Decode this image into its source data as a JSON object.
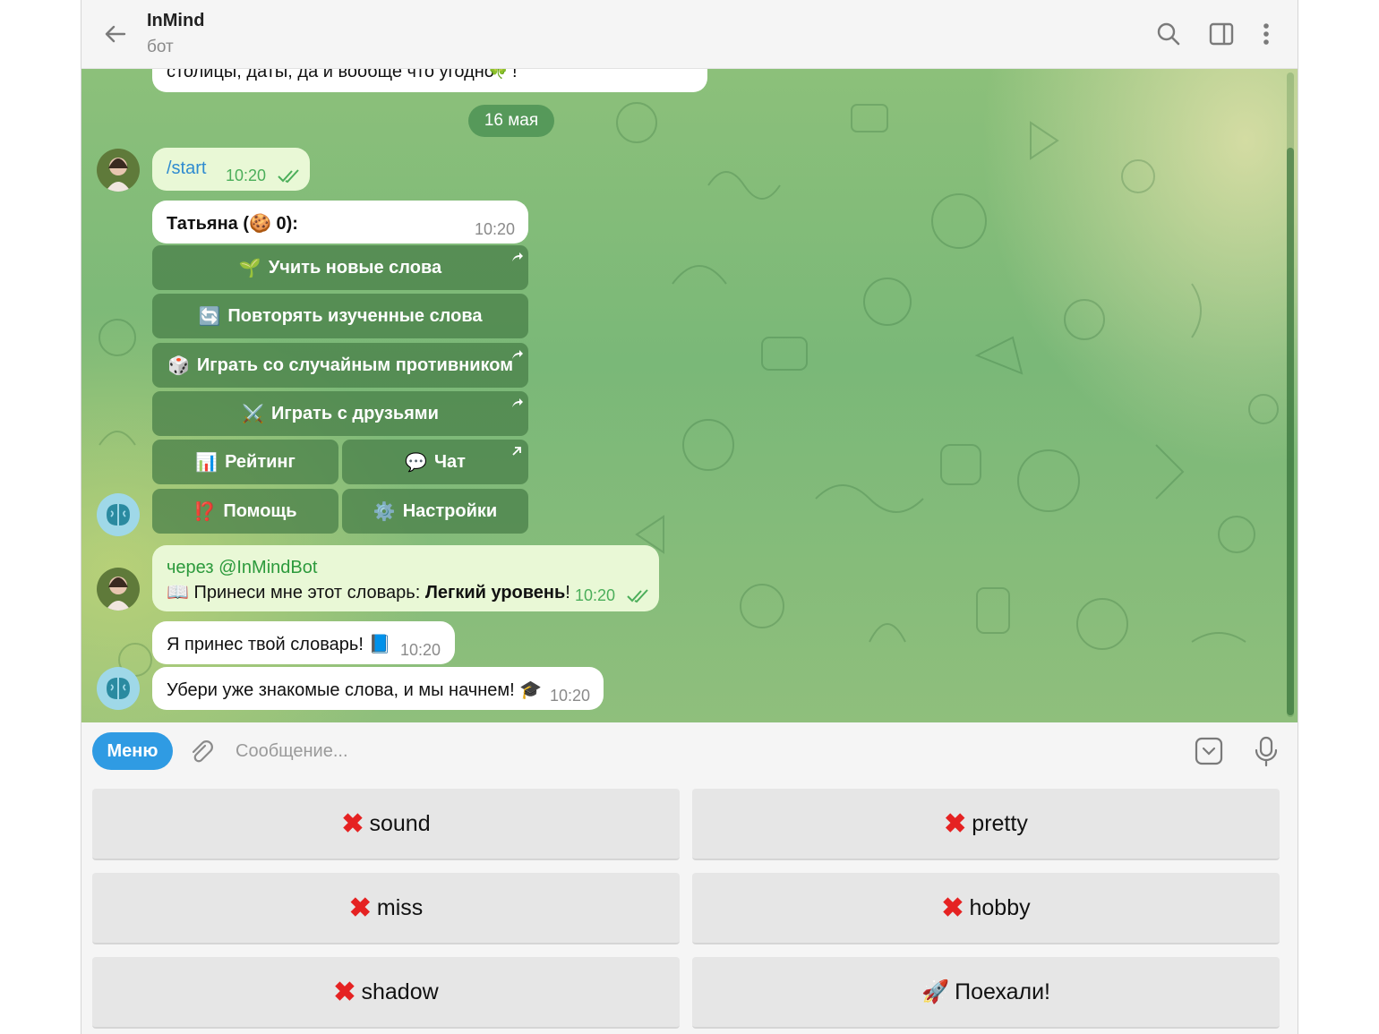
{
  "header": {
    "title": "InMind",
    "subtitle": "бот"
  },
  "chat": {
    "partial_text": "столицы, даты, да и вообще что угодно",
    "date_label": "16 мая",
    "messages": [
      {
        "text": "/start",
        "time": "10:20"
      },
      {
        "author": "Татьяна (",
        "author_suffix": " 0):",
        "time": "10:20"
      },
      {
        "via": "через @InMindBot",
        "text": "Принеси мне этот словарь:",
        "bold": "Легкий уровень",
        "tail": "!",
        "time": "10:20"
      },
      {
        "text": "Я принес твой словарь!",
        "time": "10:20"
      },
      {
        "text": "Убери уже знакомые слова, и мы начнем!",
        "time": "10:20"
      }
    ],
    "inline_buttons": {
      "learn": "Учить новые слова",
      "repeat": "Повторять изученные слова",
      "random": "Играть со случайным противником",
      "friends": "Играть с друзьями",
      "rating": "Рейтинг",
      "chat": "Чат",
      "help": "Помощь",
      "settings": "Настройки"
    }
  },
  "input": {
    "menu_label": "Меню",
    "placeholder": "Сообщение..."
  },
  "keyboard": {
    "buttons": [
      "sound",
      "pretty",
      "miss",
      "hobby",
      "shadow",
      "Поехали!"
    ]
  },
  "colors": {
    "accent": "#2f9be3",
    "chat_green": "#7ab878",
    "outgoing_bubble": "#e9f8d6",
    "inline_button": "#4f8a4f",
    "cross_red": "#e52222"
  }
}
